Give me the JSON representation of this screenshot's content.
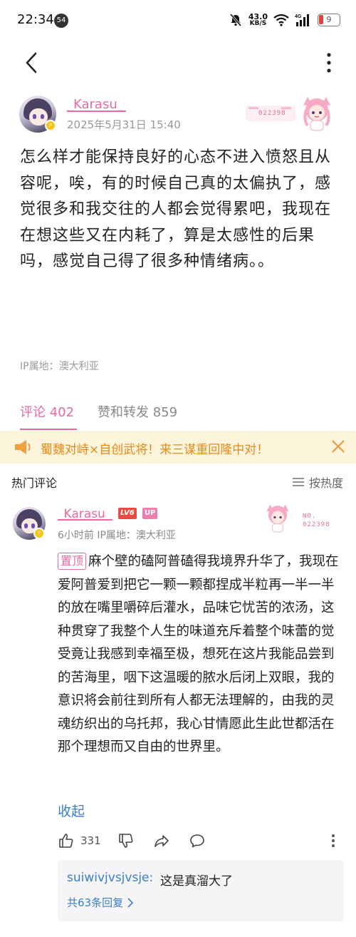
{
  "status_bar": {
    "time": "22:34",
    "notification_count": "54",
    "speed_value": "43.0",
    "speed_unit": "KB/S",
    "network": "4G",
    "battery": "9"
  },
  "post": {
    "author": "_Karasu_",
    "date": "2025年5月31日 15:40",
    "deco_number": "022398",
    "content": "怎么样才能保持良好的心态不进入愤怒且从容呢，唉，有的时候自己真的太偏执了，感觉很多和我交往的人都会觉得累吧，我现在在想这些又在内耗了，算是太感性的后果吗，感觉自己得了很多种情绪病。。",
    "ip_location": "IP属地：澳大利亚"
  },
  "tabs": [
    {
      "label": "评论 402",
      "active": true
    },
    {
      "label": "赞和转发 859",
      "active": false
    }
  ],
  "banner": {
    "text": "蜀魏对峙×自创武将！来三谋重回隆中对！"
  },
  "comments_header": {
    "title": "热门评论",
    "sort_label": "按热度"
  },
  "comment": {
    "author": "_Karasu_",
    "level": "LV6",
    "up_badge": "UP",
    "meta": "6小时前 IP属地：澳大利亚",
    "deco_number_prefix": "NO.",
    "deco_number": "022398",
    "pin_label": "置顶",
    "content": "麻个壁的磕阿普磕得我境界升华了，我现在爱阿普爱到把它一颗一颗都捏成半粒再一半一半的放在嘴里嚼碎后灌水，品味它忧苦的浓汤，这种贯穿了我整个人生的味道充斥着整个味蕾的觉受竟让我感到幸福至极，想死在这片我能品尝到的苦海里，咽下这温暖的脓水后闭上双眼，我的意识将会前往到所有人都无法理解的，由我的灵魂纺织出的乌托邦，我心甘情愿此生此世都活在那个理想而又自由的世界里。",
    "collapse_label": "收起",
    "like_count": "331",
    "reply": {
      "user": "suiwivjvsjvsje:",
      "text": "这是真溜大了",
      "more_label": "共63条回复"
    }
  },
  "colors": {
    "accent_pink": "#e86aa0",
    "link_blue": "#3b7fc7",
    "banner_bg": "#fdf4dc",
    "banner_text": "#e48a18"
  }
}
